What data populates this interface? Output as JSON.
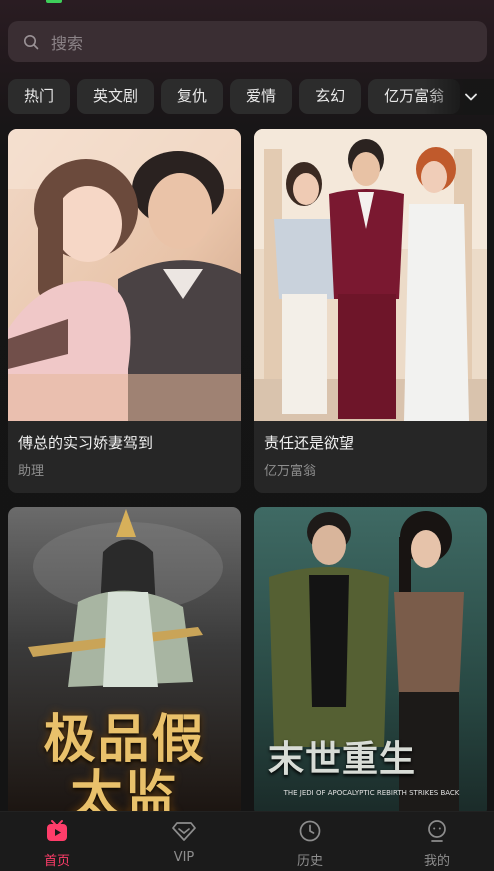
{
  "search": {
    "placeholder": "搜索"
  },
  "tags": [
    "热门",
    "英文剧",
    "复仇",
    "爱情",
    "玄幻",
    "亿万富翁"
  ],
  "cards": [
    {
      "title": "傅总的实习娇妻驾到",
      "tag": "助理"
    },
    {
      "title": "责任还是欲望",
      "tag": "亿万富翁"
    },
    {
      "title": "",
      "tag": "",
      "poster_text": "极品假太监"
    },
    {
      "title": "",
      "tag": "",
      "poster_text": "末世重生",
      "poster_subtext": "THE JEDI OF APOCALYPTIC REBIRTH STRIKES BACK"
    }
  ],
  "nav": [
    {
      "label": "首页",
      "icon": "home-icon",
      "active": true
    },
    {
      "label": "VIP",
      "icon": "vip-diamond-icon",
      "active": false
    },
    {
      "label": "历史",
      "icon": "history-clock-icon",
      "active": false
    },
    {
      "label": "我的",
      "icon": "profile-icon",
      "active": false
    }
  ],
  "colors": {
    "accent": "#ff3d6a",
    "background": "#151515",
    "card": "#262626"
  }
}
